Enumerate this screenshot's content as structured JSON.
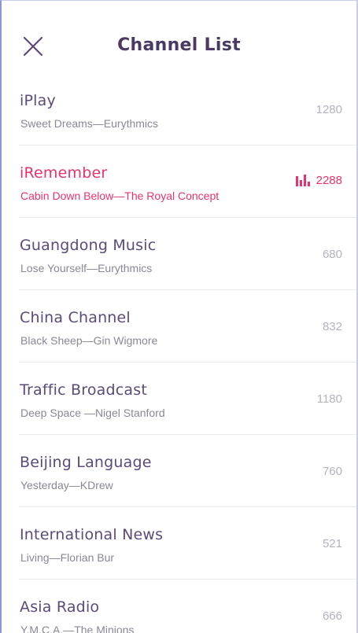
{
  "header": {
    "title": "Channel List",
    "close_icon": "close-icon"
  },
  "accent_color": "#e8336d",
  "channels": [
    {
      "name": "iPlay",
      "song": "Sweet Dreams—Eurythmics",
      "frequency": "1280",
      "active": false
    },
    {
      "name": "iRemember",
      "song": "Cabin Down Below—The Royal Concept",
      "frequency": "2288",
      "active": true,
      "indicator_icon": "equalizer-icon"
    },
    {
      "name": "Guangdong Music",
      "song": "Lose Yourself—Eurythmics",
      "frequency": "680",
      "active": false
    },
    {
      "name": "China Channel",
      "song": "Black Sheep—Gin Wigmore",
      "frequency": "832",
      "active": false
    },
    {
      "name": "Traffic Broadcast",
      "song": "Deep Space —Nigel Stanford",
      "frequency": "1180",
      "active": false
    },
    {
      "name": "Beijing Language",
      "song": "Yesterday—KDrew",
      "frequency": "760",
      "active": false
    },
    {
      "name": "International News",
      "song": "Living—Florian Bur",
      "frequency": "521",
      "active": false
    },
    {
      "name": "Asia Radio",
      "song": "Y.M.C.A.—The Minions",
      "frequency": "666",
      "active": false
    }
  ]
}
